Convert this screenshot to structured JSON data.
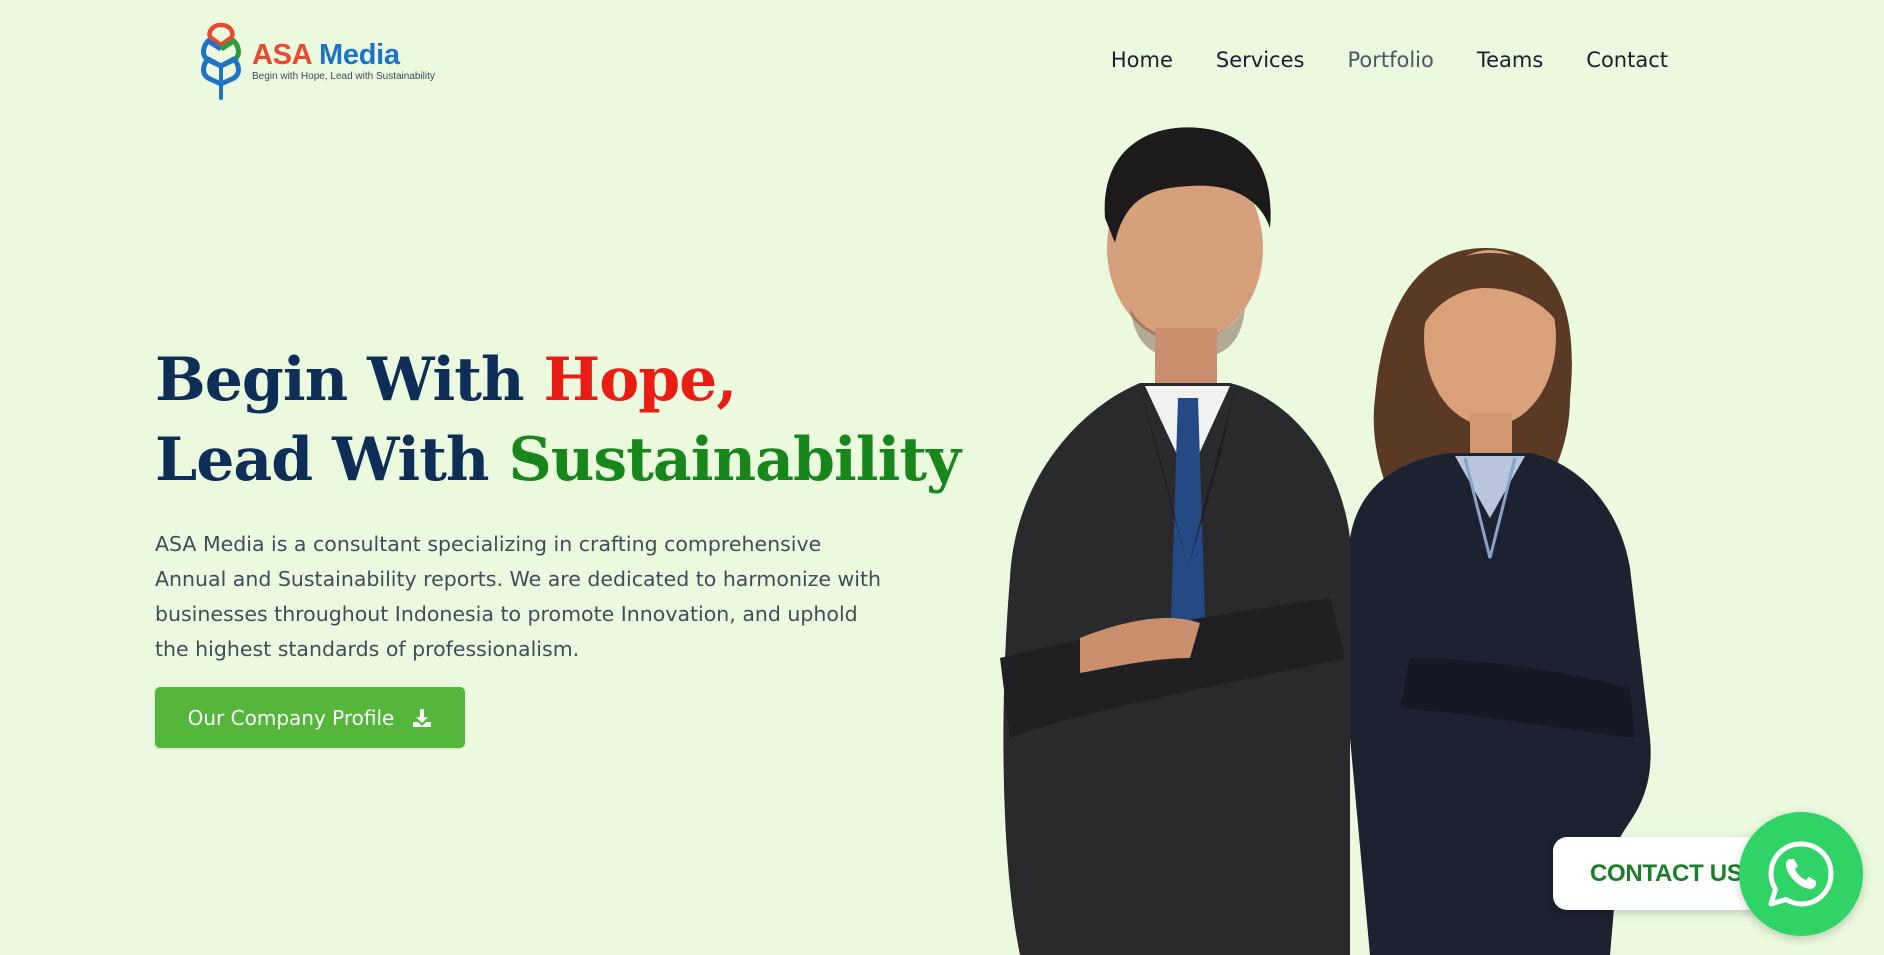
{
  "brand": {
    "name_part1": "ASA",
    "name_part2": "Media",
    "tagline": "Begin with Hope, Lead with Sustainability",
    "colors": {
      "red": "#e8492f",
      "blue": "#1f73c4",
      "green": "#2f9a3a"
    }
  },
  "nav": {
    "items": [
      {
        "label": "Home"
      },
      {
        "label": "Services"
      },
      {
        "label": "Portfolio",
        "active": true
      },
      {
        "label": "Teams"
      },
      {
        "label": "Contact"
      }
    ]
  },
  "hero": {
    "headline_line1_prefix": "Begin With ",
    "headline_line1_highlight": "Hope,",
    "headline_line2_prefix": "Lead With ",
    "headline_line2_highlight": "Sustainability",
    "description": "ASA Media is a consultant specializing in crafting comprehensive Annual and Sustainability reports. We are dedicated to harmonize with businesses throughout Indonesia to promote Innovation, and uphold the highest standards of professionalism.",
    "cta_label": "Our Company Profile",
    "cta_icon": "download-icon",
    "colors": {
      "navy": "#0e2d57",
      "hope_red": "#ea1d15",
      "sustainability_green": "#17871b",
      "button_green": "#55b63c"
    }
  },
  "floating_contact": {
    "label": "CONTACT US",
    "icon": "whatsapp-icon",
    "color": "#2fd366"
  }
}
